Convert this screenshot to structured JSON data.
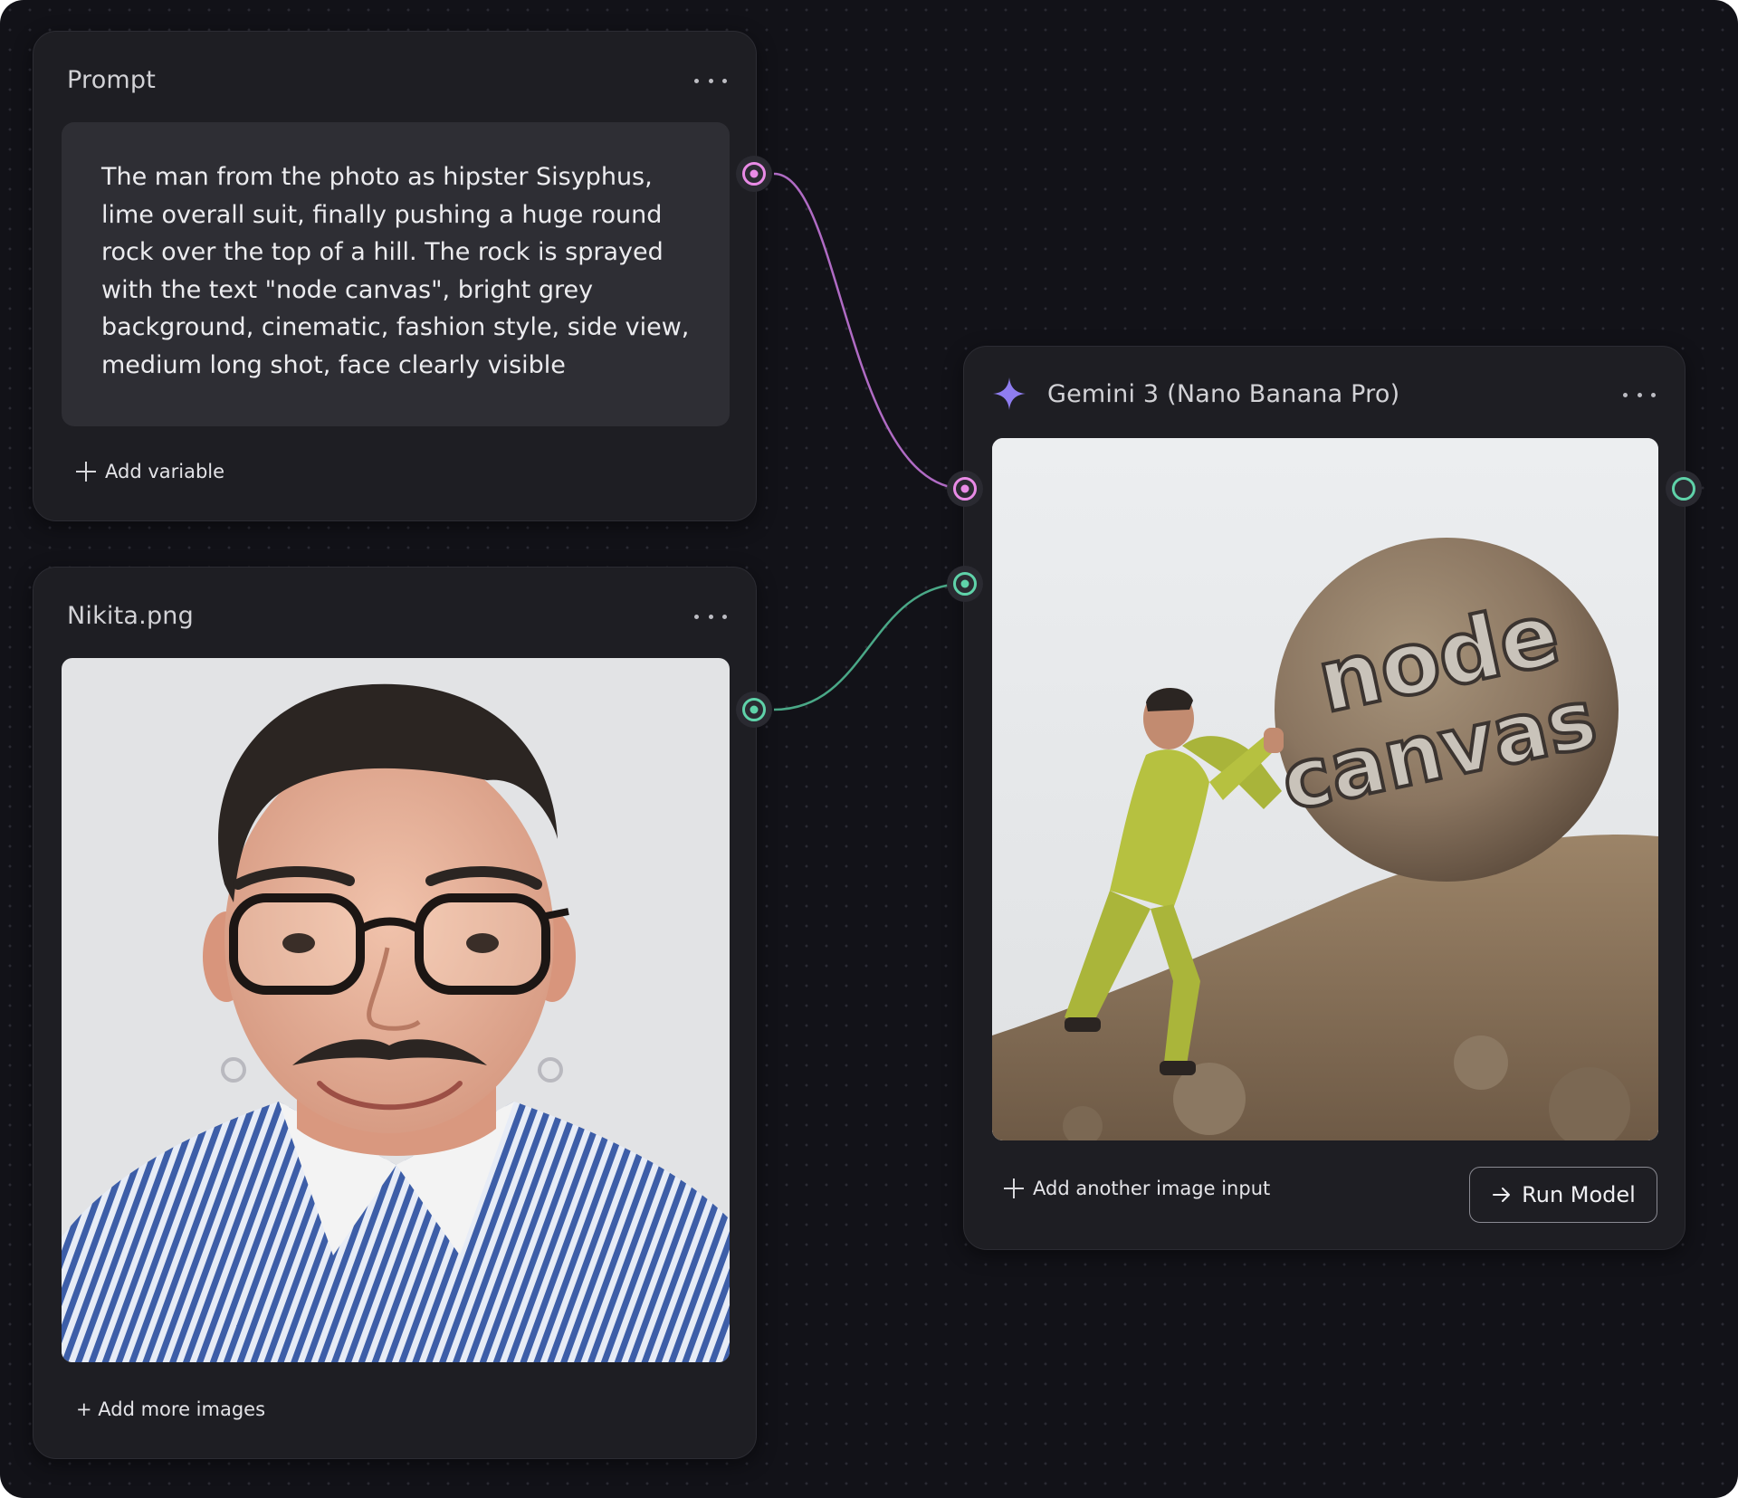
{
  "prompt_node": {
    "title": "Prompt",
    "text": "The man from the photo as hipster Sisyphus, lime overall suit, finally pushing a huge round rock over the top of a hill. The rock is sprayed with the text \"node canvas\", bright grey background, cinematic, fashion style, side view, medium long shot, face clearly visible",
    "add_variable_label": "Add variable"
  },
  "image_node": {
    "title": "Nikita.png",
    "add_more_label": "+ Add more images"
  },
  "model_node": {
    "title": "Gemini 3 (Nano Banana Pro)",
    "result_image_text": "node canvas",
    "add_input_label": "Add another image input",
    "run_label": "Run Model"
  },
  "colors": {
    "prompt_port": "#e98be6",
    "image_port": "#5fd2a9",
    "sparkle": "#8f7df0"
  },
  "icons": {
    "menu": "ellipsis-icon",
    "add": "plus-icon",
    "model": "sparkle-icon",
    "run": "arrow-right-icon"
  }
}
